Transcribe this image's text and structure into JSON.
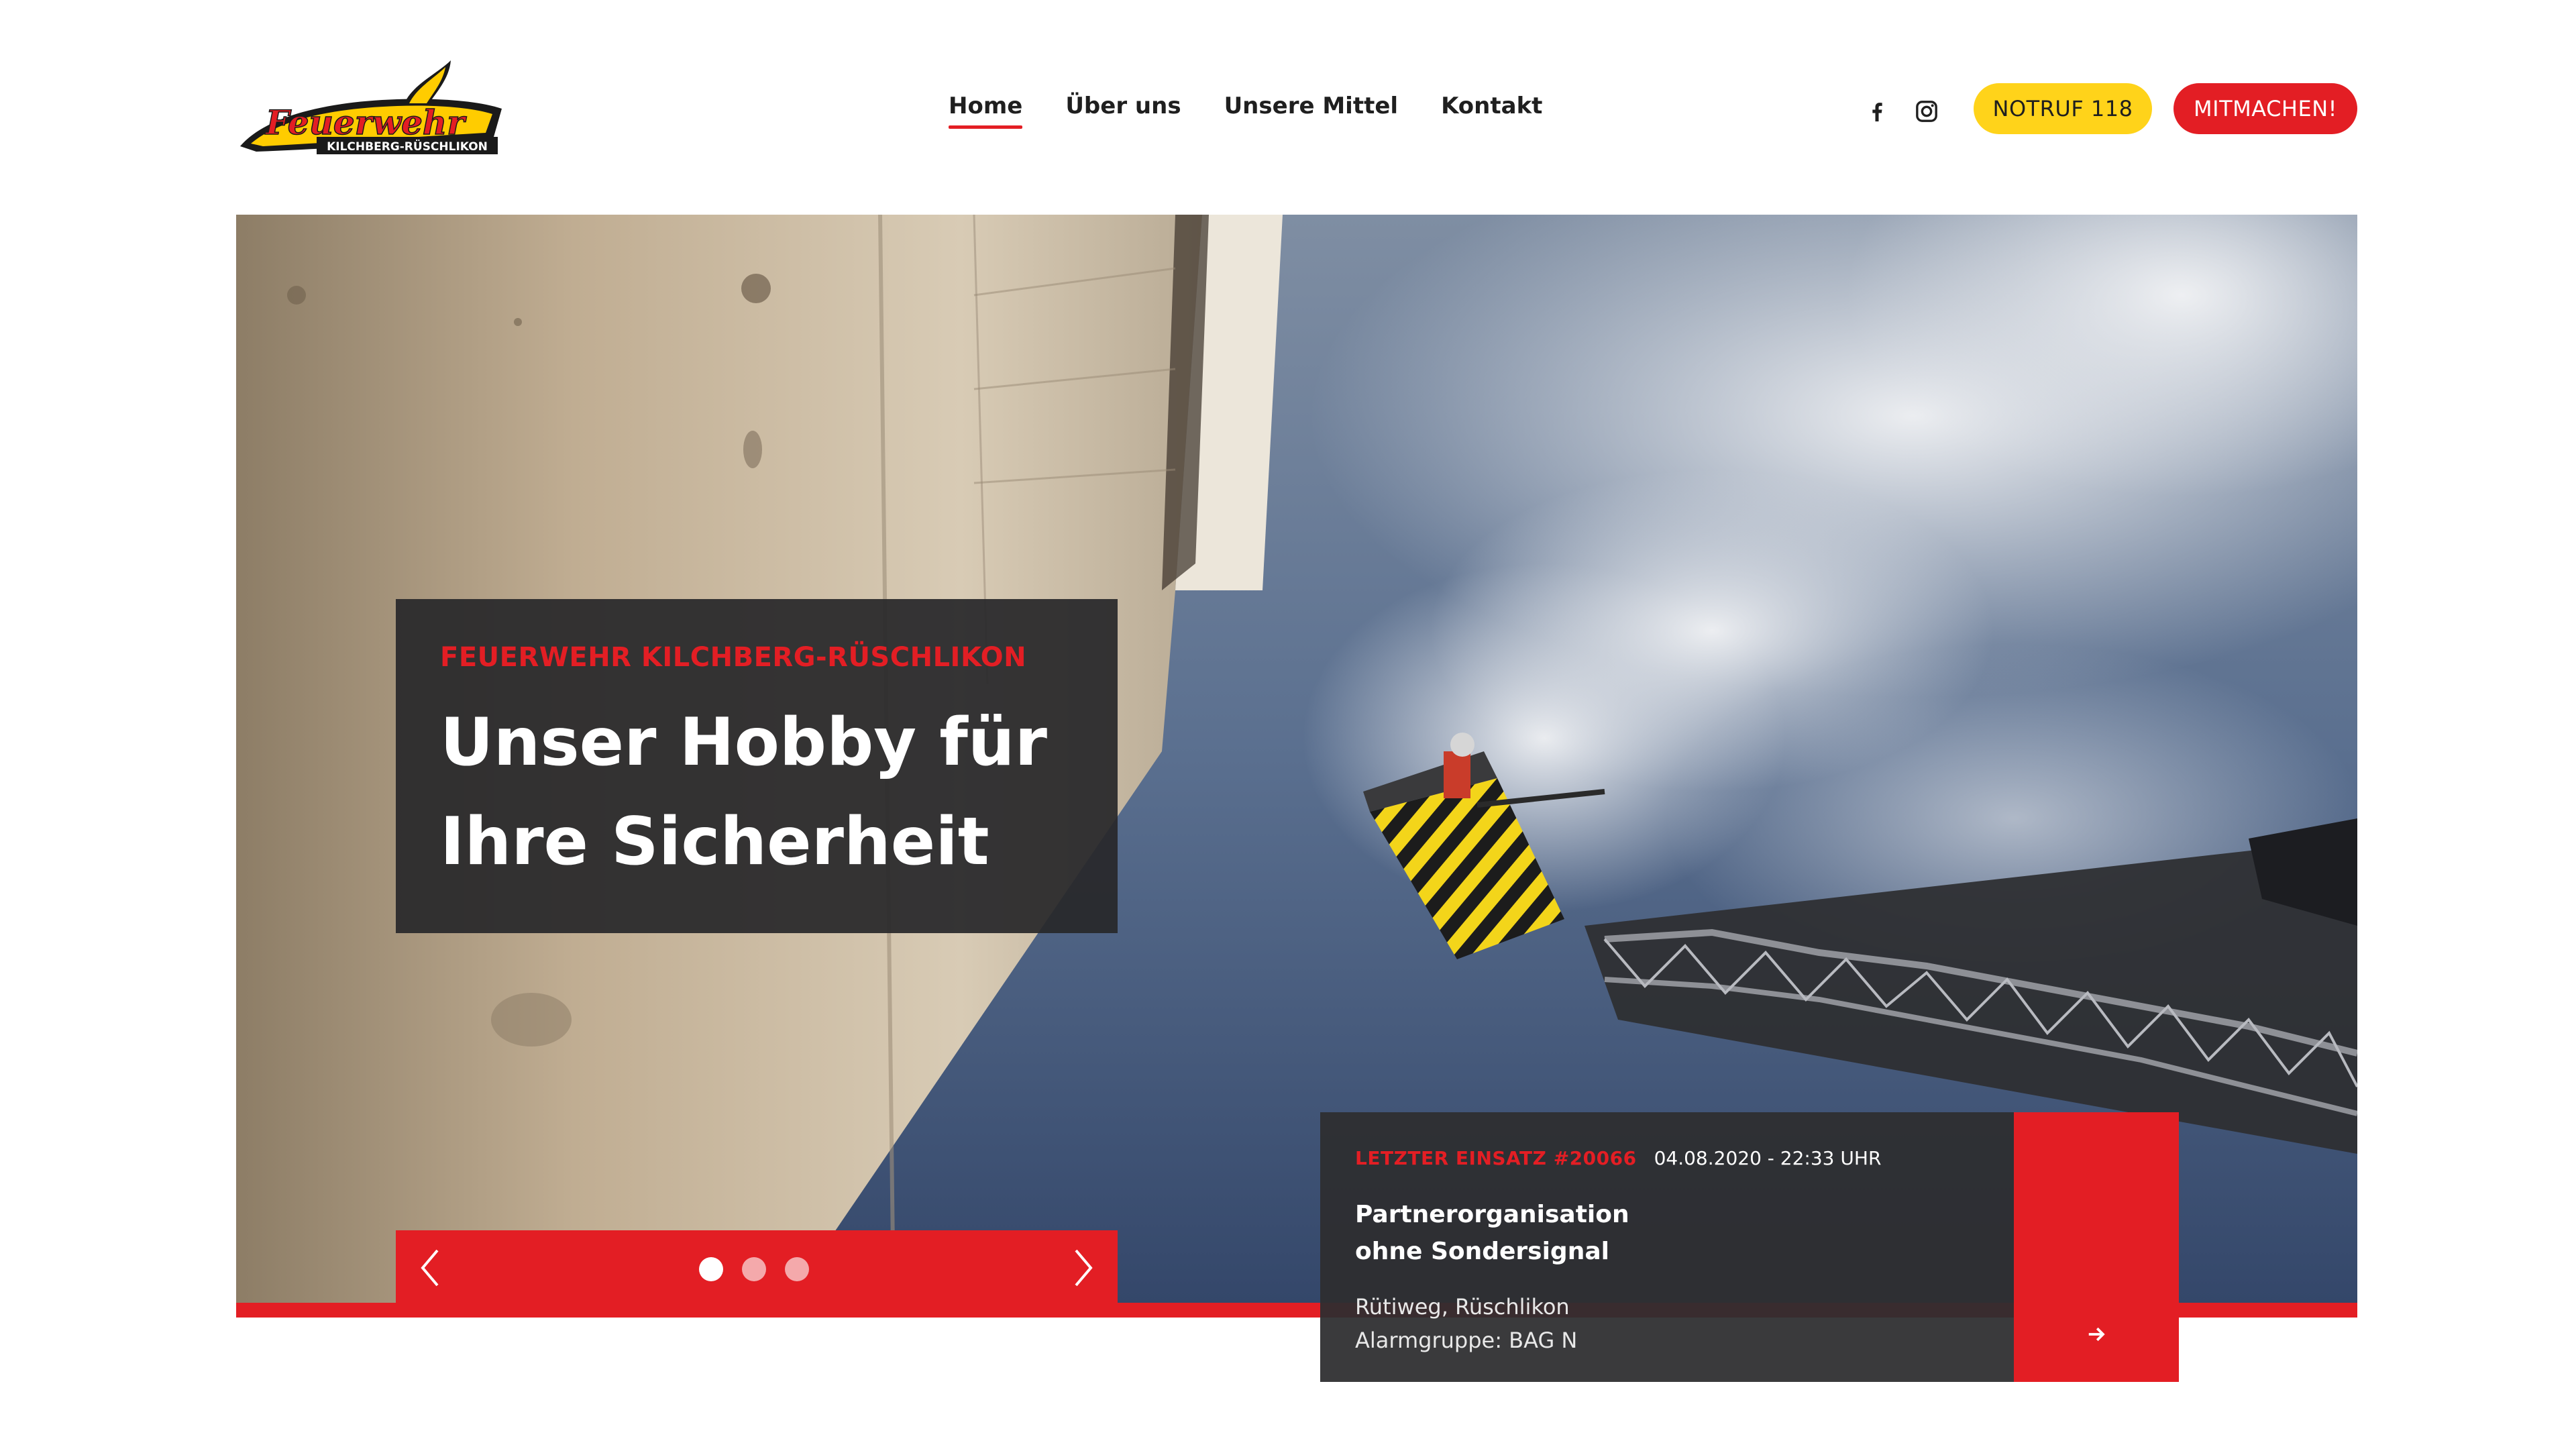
{
  "brand": {
    "logo_wordmark": "Feuerwehr",
    "logo_subline": "KILCHBERG-RÜSCHLIKON",
    "colors": {
      "red": "#e31e24",
      "yellow": "#ffd31a",
      "dark": "#28282a"
    }
  },
  "nav": {
    "items": [
      {
        "label": "Home",
        "active": true
      },
      {
        "label": "Über uns",
        "active": false
      },
      {
        "label": "Unsere Mittel",
        "active": false
      },
      {
        "label": "Kontakt",
        "active": false
      }
    ]
  },
  "social": {
    "icons": [
      "facebook-icon",
      "instagram-icon"
    ]
  },
  "actions": {
    "notruf_label": "NOTRUF 118",
    "mitmachen_label": "MITMACHEN!"
  },
  "hero": {
    "eyebrow": "FEUERWEHR KILCHBERG-RÜSCHLIKON",
    "title": "Unser Hobby für\nIhre Sicherheit",
    "slider": {
      "slide_count": 3,
      "active_slide": 1,
      "prev_icon": "chevron-left-icon",
      "next_icon": "chevron-right-icon"
    }
  },
  "last_deployment": {
    "label": "LETZTER EINSATZ #20066",
    "datetime": "04.08.2020 - 22:33 UHR",
    "title": "Partnerorganisation\nohne Sondersignal",
    "location": "Rütiweg, Rüschlikon",
    "alarm_group": "Alarmgruppe: BAG N",
    "go_icon": "arrow-right-icon"
  }
}
